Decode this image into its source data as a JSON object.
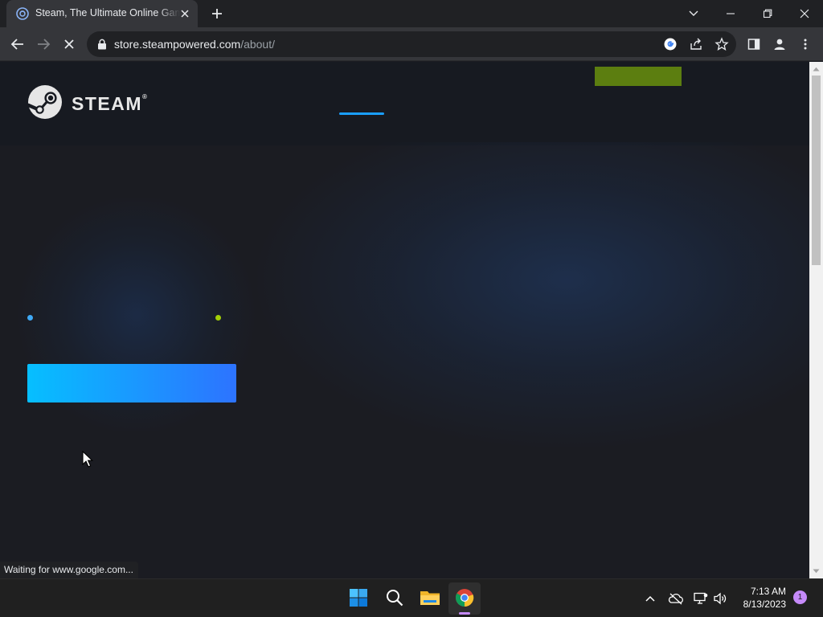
{
  "browser": {
    "tab": {
      "title": "Steam, The Ultimate Online Game Platform",
      "favicon": "steam-favicon-icon"
    },
    "address_bar": {
      "url_host": "store.steampowered.com",
      "url_path": "/about/"
    },
    "status_text": "Waiting for www.google.com..."
  },
  "page": {
    "brand": "STEAM",
    "brand_mark": "®",
    "colors": {
      "header_bg": "#171a21",
      "nav_accent": "#1a9fff",
      "install_button": "#5c7e10",
      "cta_gradient_start": "#06bfff",
      "cta_gradient_end": "#2d73ff",
      "dot_blue": "#3fa9f5",
      "dot_green": "#a3cf06"
    }
  },
  "taskbar": {
    "apps": [
      "start-icon",
      "search-icon",
      "file-explorer-icon",
      "chrome-icon"
    ],
    "clock": {
      "time": "7:13 AM",
      "date": "8/13/2023"
    },
    "notification_count": "1"
  }
}
